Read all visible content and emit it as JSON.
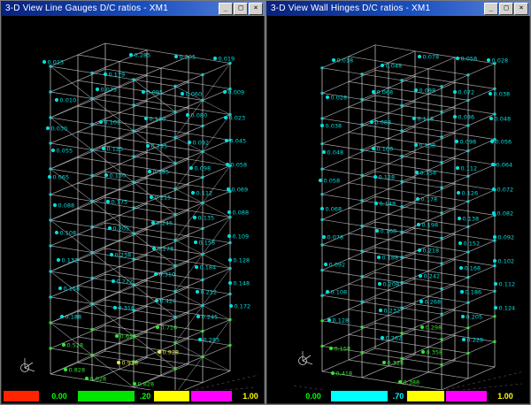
{
  "colors": {
    "c": "#00dfdf",
    "g": "#2ee62e",
    "y": "#e8e84a",
    "joint": "#18cfcf",
    "joint_base": "#2ee62e",
    "wire": "#d8d8d8",
    "gauge": "#c0c0c0"
  },
  "window_buttons": {
    "minimize": "_",
    "maximize": "□",
    "close": "×"
  },
  "windows": [
    {
      "title": "3-D View  Line Gauges D/C ratios - XM1",
      "legend": [
        {
          "t": "sw",
          "color": "#ff2400",
          "w": 40
        },
        {
          "t": "lb",
          "text": "0.00",
          "color": "#00ff00",
          "w": 42
        },
        {
          "t": "sw",
          "color": "#00e400",
          "w": 64
        },
        {
          "t": "lb",
          "text": ".20",
          "color": "#00ff00",
          "w": 20
        },
        {
          "t": "sw",
          "color": "#ffff00",
          "w": 40
        },
        {
          "t": "sw",
          "color": "#ff00ff",
          "w": 46
        },
        {
          "t": "lb",
          "text": "1.00",
          "color": "#ffff00",
          "w": 38
        }
      ],
      "points": [
        [
          48,
          52,
          "0.015",
          "c"
        ],
        [
          117,
          66,
          "0.179",
          "c"
        ],
        [
          146,
          44,
          "0.285",
          "c"
        ],
        [
          197,
          46,
          "0.205",
          "c"
        ],
        [
          241,
          48,
          "0.019",
          "c"
        ],
        [
          62,
          95,
          "0.010",
          "c"
        ],
        [
          108,
          83,
          "0.075",
          "c"
        ],
        [
          160,
          86,
          "0.095",
          "c"
        ],
        [
          204,
          88,
          "0.060",
          "c"
        ],
        [
          252,
          86,
          "0.009",
          "c"
        ],
        [
          52,
          127,
          "0.030",
          "c"
        ],
        [
          112,
          120,
          "0.105",
          "c"
        ],
        [
          163,
          116,
          "0.130",
          "c"
        ],
        [
          210,
          112,
          "0.080",
          "c"
        ],
        [
          253,
          115,
          "0.023",
          "c"
        ],
        [
          58,
          152,
          "0.055",
          "c"
        ],
        [
          115,
          150,
          "0.125",
          "c"
        ],
        [
          165,
          147,
          "0.155",
          "c"
        ],
        [
          212,
          143,
          "0.092",
          "c"
        ],
        [
          254,
          141,
          "0.045",
          "c"
        ],
        [
          54,
          182,
          "0.065",
          "c"
        ],
        [
          118,
          180,
          "0.150",
          "c"
        ],
        [
          167,
          176,
          "0.185",
          "c"
        ],
        [
          214,
          172,
          "0.098",
          "c"
        ],
        [
          255,
          168,
          "0.058",
          "c"
        ],
        [
          60,
          214,
          "0.088",
          "c"
        ],
        [
          120,
          210,
          "0.175",
          "c"
        ],
        [
          169,
          205,
          "0.215",
          "c"
        ],
        [
          216,
          200,
          "0.112",
          "c"
        ],
        [
          256,
          196,
          "0.069",
          "c"
        ],
        [
          62,
          245,
          "0.108",
          "c"
        ],
        [
          122,
          240,
          "0.205",
          "c"
        ],
        [
          171,
          234,
          "0.245",
          "c"
        ],
        [
          218,
          228,
          "0.135",
          "c"
        ],
        [
          257,
          222,
          "0.088",
          "c"
        ],
        [
          64,
          276,
          "0.132",
          "c"
        ],
        [
          124,
          270,
          "0.238",
          "c"
        ],
        [
          172,
          263,
          "0.278",
          "c"
        ],
        [
          219,
          256,
          "0.158",
          "c"
        ],
        [
          257,
          249,
          "0.109",
          "c"
        ],
        [
          66,
          308,
          "0.158",
          "c"
        ],
        [
          126,
          300,
          "0.272",
          "c"
        ],
        [
          174,
          292,
          "0.310",
          "c"
        ],
        [
          220,
          284,
          "0.184",
          "c"
        ],
        [
          258,
          276,
          "0.128",
          "c"
        ],
        [
          68,
          340,
          "0.188",
          "c"
        ],
        [
          128,
          330,
          "0.316",
          "c"
        ],
        [
          175,
          322,
          "0.420",
          "c"
        ],
        [
          221,
          312,
          "0.212",
          "c"
        ],
        [
          258,
          302,
          "0.148",
          "c"
        ],
        [
          70,
          372,
          "0.528",
          "g"
        ],
        [
          130,
          362,
          "0.616",
          "g"
        ],
        [
          176,
          352,
          "0.716",
          "g"
        ],
        [
          222,
          340,
          "0.245",
          "c"
        ],
        [
          259,
          328,
          "0.172",
          "c"
        ],
        [
          72,
          400,
          "0.828",
          "g"
        ],
        [
          132,
          392,
          "0.918",
          "y"
        ],
        [
          178,
          380,
          "0.928",
          "y"
        ],
        [
          224,
          366,
          "0.285",
          "c"
        ],
        [
          150,
          416,
          "0.828",
          "g"
        ],
        [
          96,
          410,
          "0.628",
          "g"
        ]
      ]
    },
    {
      "title": "3-D View  Wall Hinges D/C ratios - XM1",
      "legend": [
        {
          "t": "gap",
          "w": 30
        },
        {
          "t": "lb",
          "text": "0.00",
          "color": "#00ff00",
          "w": 40
        },
        {
          "t": "sw",
          "color": "#00ffff",
          "w": 64
        },
        {
          "t": "lb",
          "text": ".70",
          "color": "#00ffff",
          "w": 20
        },
        {
          "t": "sw",
          "color": "#ffff00",
          "w": 42
        },
        {
          "t": "sw",
          "color": "#ff00ff",
          "w": 46
        },
        {
          "t": "lb",
          "text": "1.00",
          "color": "#ffff00",
          "w": 38
        }
      ],
      "points": [
        [
          75,
          50,
          "0.018",
          "c"
        ],
        [
          130,
          56,
          "0.048",
          "c"
        ],
        [
          172,
          46,
          "0.078",
          "c"
        ],
        [
          215,
          48,
          "0.058",
          "c"
        ],
        [
          250,
          50,
          "0.028",
          "c"
        ],
        [
          68,
          92,
          "0.028",
          "c"
        ],
        [
          120,
          86,
          "0.068",
          "c"
        ],
        [
          168,
          84,
          "0.098",
          "c"
        ],
        [
          212,
          86,
          "0.072",
          "c"
        ],
        [
          252,
          88,
          "0.038",
          "c"
        ],
        [
          62,
          124,
          "0.038",
          "c"
        ],
        [
          118,
          120,
          "0.088",
          "c"
        ],
        [
          166,
          116,
          "0.118",
          "c"
        ],
        [
          212,
          114,
          "0.086",
          "c"
        ],
        [
          253,
          116,
          "0.048",
          "c"
        ],
        [
          64,
          154,
          "0.048",
          "c"
        ],
        [
          120,
          150,
          "0.108",
          "c"
        ],
        [
          168,
          146,
          "0.138",
          "c"
        ],
        [
          214,
          142,
          "0.098",
          "c"
        ],
        [
          254,
          142,
          "0.056",
          "c"
        ],
        [
          60,
          186,
          "0.058",
          "c"
        ],
        [
          122,
          182,
          "0.128",
          "c"
        ],
        [
          169,
          177,
          "0.158",
          "c"
        ],
        [
          215,
          172,
          "0.112",
          "c"
        ],
        [
          255,
          168,
          "0.064",
          "c"
        ],
        [
          62,
          218,
          "0.068",
          "c"
        ],
        [
          123,
          212,
          "0.148",
          "c"
        ],
        [
          170,
          207,
          "0.178",
          "c"
        ],
        [
          216,
          200,
          "0.126",
          "c"
        ],
        [
          256,
          196,
          "0.072",
          "c"
        ],
        [
          64,
          250,
          "0.078",
          "c"
        ],
        [
          124,
          243,
          "0.168",
          "c"
        ],
        [
          171,
          236,
          "0.198",
          "c"
        ],
        [
          217,
          229,
          "0.138",
          "c"
        ],
        [
          256,
          223,
          "0.082",
          "c"
        ],
        [
          66,
          281,
          "0.092",
          "c"
        ],
        [
          126,
          273,
          "0.188",
          "c"
        ],
        [
          172,
          265,
          "0.218",
          "c"
        ],
        [
          218,
          257,
          "0.152",
          "c"
        ],
        [
          257,
          250,
          "0.092",
          "c"
        ],
        [
          68,
          312,
          "0.108",
          "c"
        ],
        [
          127,
          303,
          "0.208",
          "c"
        ],
        [
          173,
          294,
          "0.242",
          "c"
        ],
        [
          219,
          285,
          "0.168",
          "c"
        ],
        [
          257,
          277,
          "0.102",
          "c"
        ],
        [
          70,
          344,
          "0.128",
          "c"
        ],
        [
          128,
          333,
          "0.232",
          "c"
        ],
        [
          174,
          323,
          "0.268",
          "c"
        ],
        [
          220,
          312,
          "0.186",
          "c"
        ],
        [
          258,
          303,
          "0.112",
          "c"
        ],
        [
          72,
          376,
          "0.158",
          "g"
        ],
        [
          130,
          364,
          "0.262",
          "c"
        ],
        [
          175,
          352,
          "0.298",
          "g"
        ],
        [
          221,
          340,
          "0.205",
          "c"
        ],
        [
          258,
          330,
          "0.124",
          "c"
        ],
        [
          74,
          404,
          "0.418",
          "g"
        ],
        [
          132,
          392,
          "0.328",
          "g"
        ],
        [
          176,
          380,
          "0.358",
          "g"
        ],
        [
          222,
          366,
          "0.228",
          "c"
        ],
        [
          150,
          414,
          "0.388",
          "g"
        ]
      ]
    }
  ]
}
